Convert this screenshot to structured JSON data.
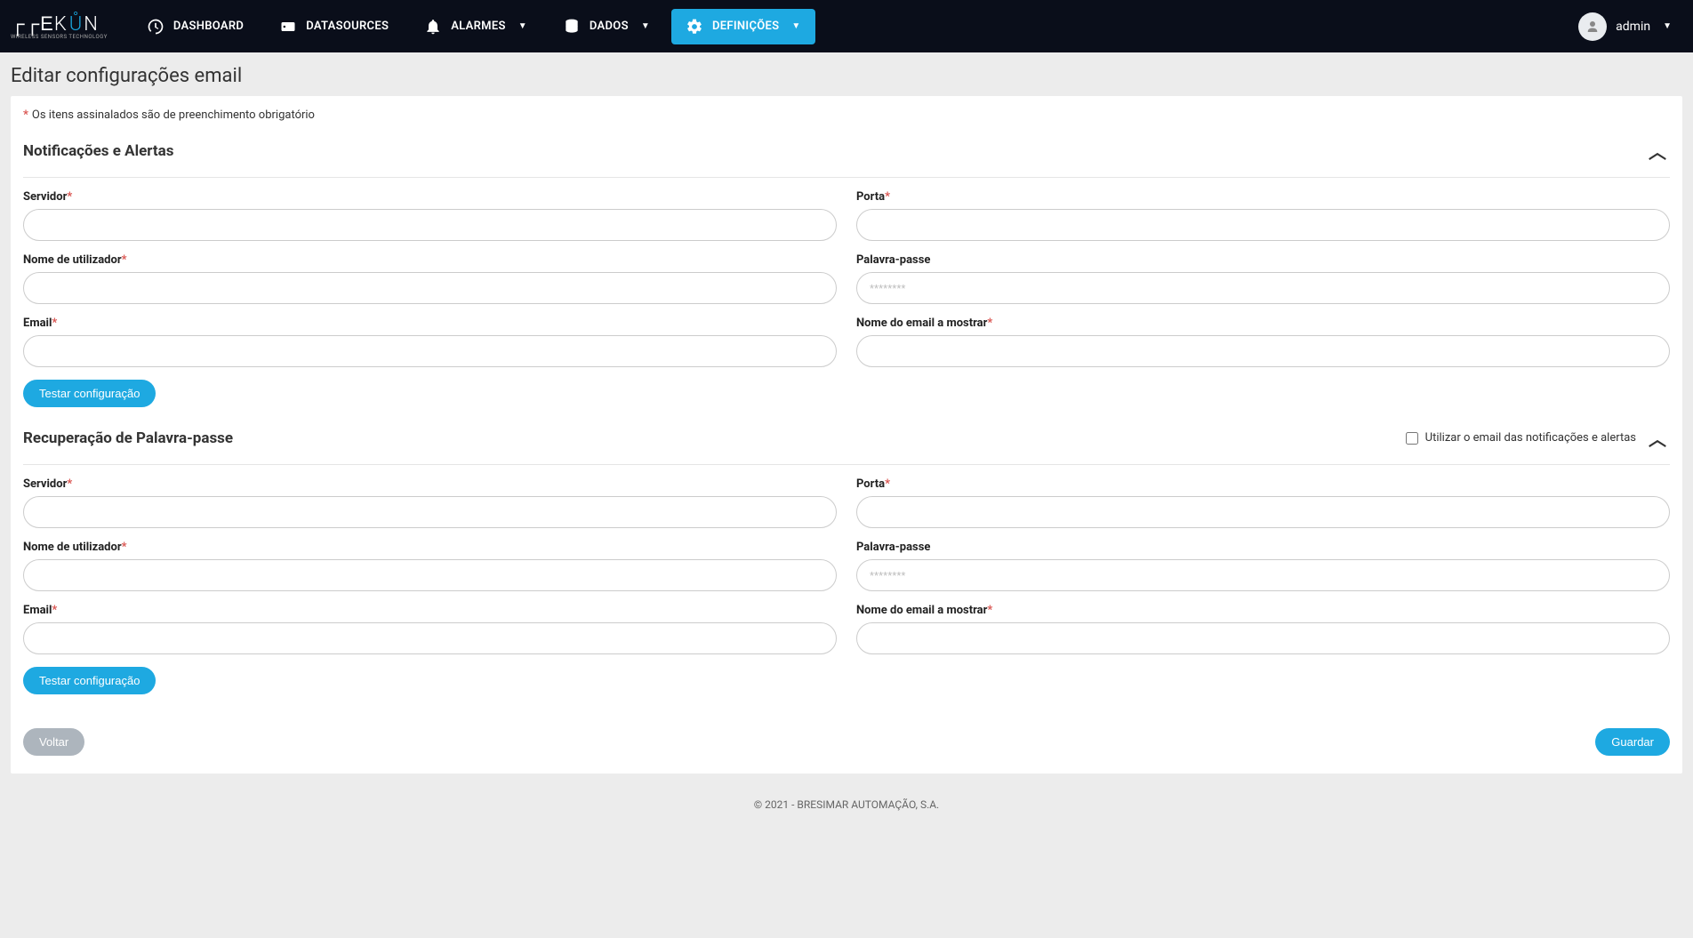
{
  "brand": {
    "name": "TEK",
    "accent": "ON",
    "tagline": "WIRELESS SENSORS TECHNOLOGY"
  },
  "nav": {
    "dashboard": "DASHBOARD",
    "datasources": "DATASOURCES",
    "alarmes": "ALARMES",
    "dados": "DADOS",
    "definicoes": "DEFINIÇÕES"
  },
  "user": {
    "name": "admin"
  },
  "page": {
    "title": "Editar configurações email",
    "required_note": "Os itens assinalados são de preenchimento obrigatório"
  },
  "section1": {
    "title": "Notificações e Alertas",
    "servidor_label": "Servidor",
    "porta_label": "Porta",
    "nome_utilizador_label": "Nome de utilizador",
    "palavra_passe_label": "Palavra-passe",
    "palavra_passe_placeholder": "********",
    "email_label": "Email",
    "nome_email_mostrar_label": "Nome do email a mostrar",
    "testar_btn": "Testar configuração",
    "servidor_value": "",
    "porta_value": "",
    "nome_utilizador_value": "",
    "palavra_passe_value": "",
    "email_value": "",
    "nome_email_mostrar_value": ""
  },
  "section2": {
    "title": "Recuperação de Palavra-passe",
    "use_notif_email_label": "Utilizar o email das notificações e alertas",
    "servidor_label": "Servidor",
    "porta_label": "Porta",
    "nome_utilizador_label": "Nome de utilizador",
    "palavra_passe_label": "Palavra-passe",
    "palavra_passe_placeholder": "********",
    "email_label": "Email",
    "nome_email_mostrar_label": "Nome do email a mostrar",
    "testar_btn": "Testar configuração",
    "servidor_value": "",
    "porta_value": "",
    "nome_utilizador_value": "",
    "palavra_passe_value": "",
    "email_value": "",
    "nome_email_mostrar_value": ""
  },
  "actions": {
    "voltar": "Voltar",
    "guardar": "Guardar"
  },
  "footer": "© 2021 - BRESIMAR AUTOMAÇÃO, S.A."
}
